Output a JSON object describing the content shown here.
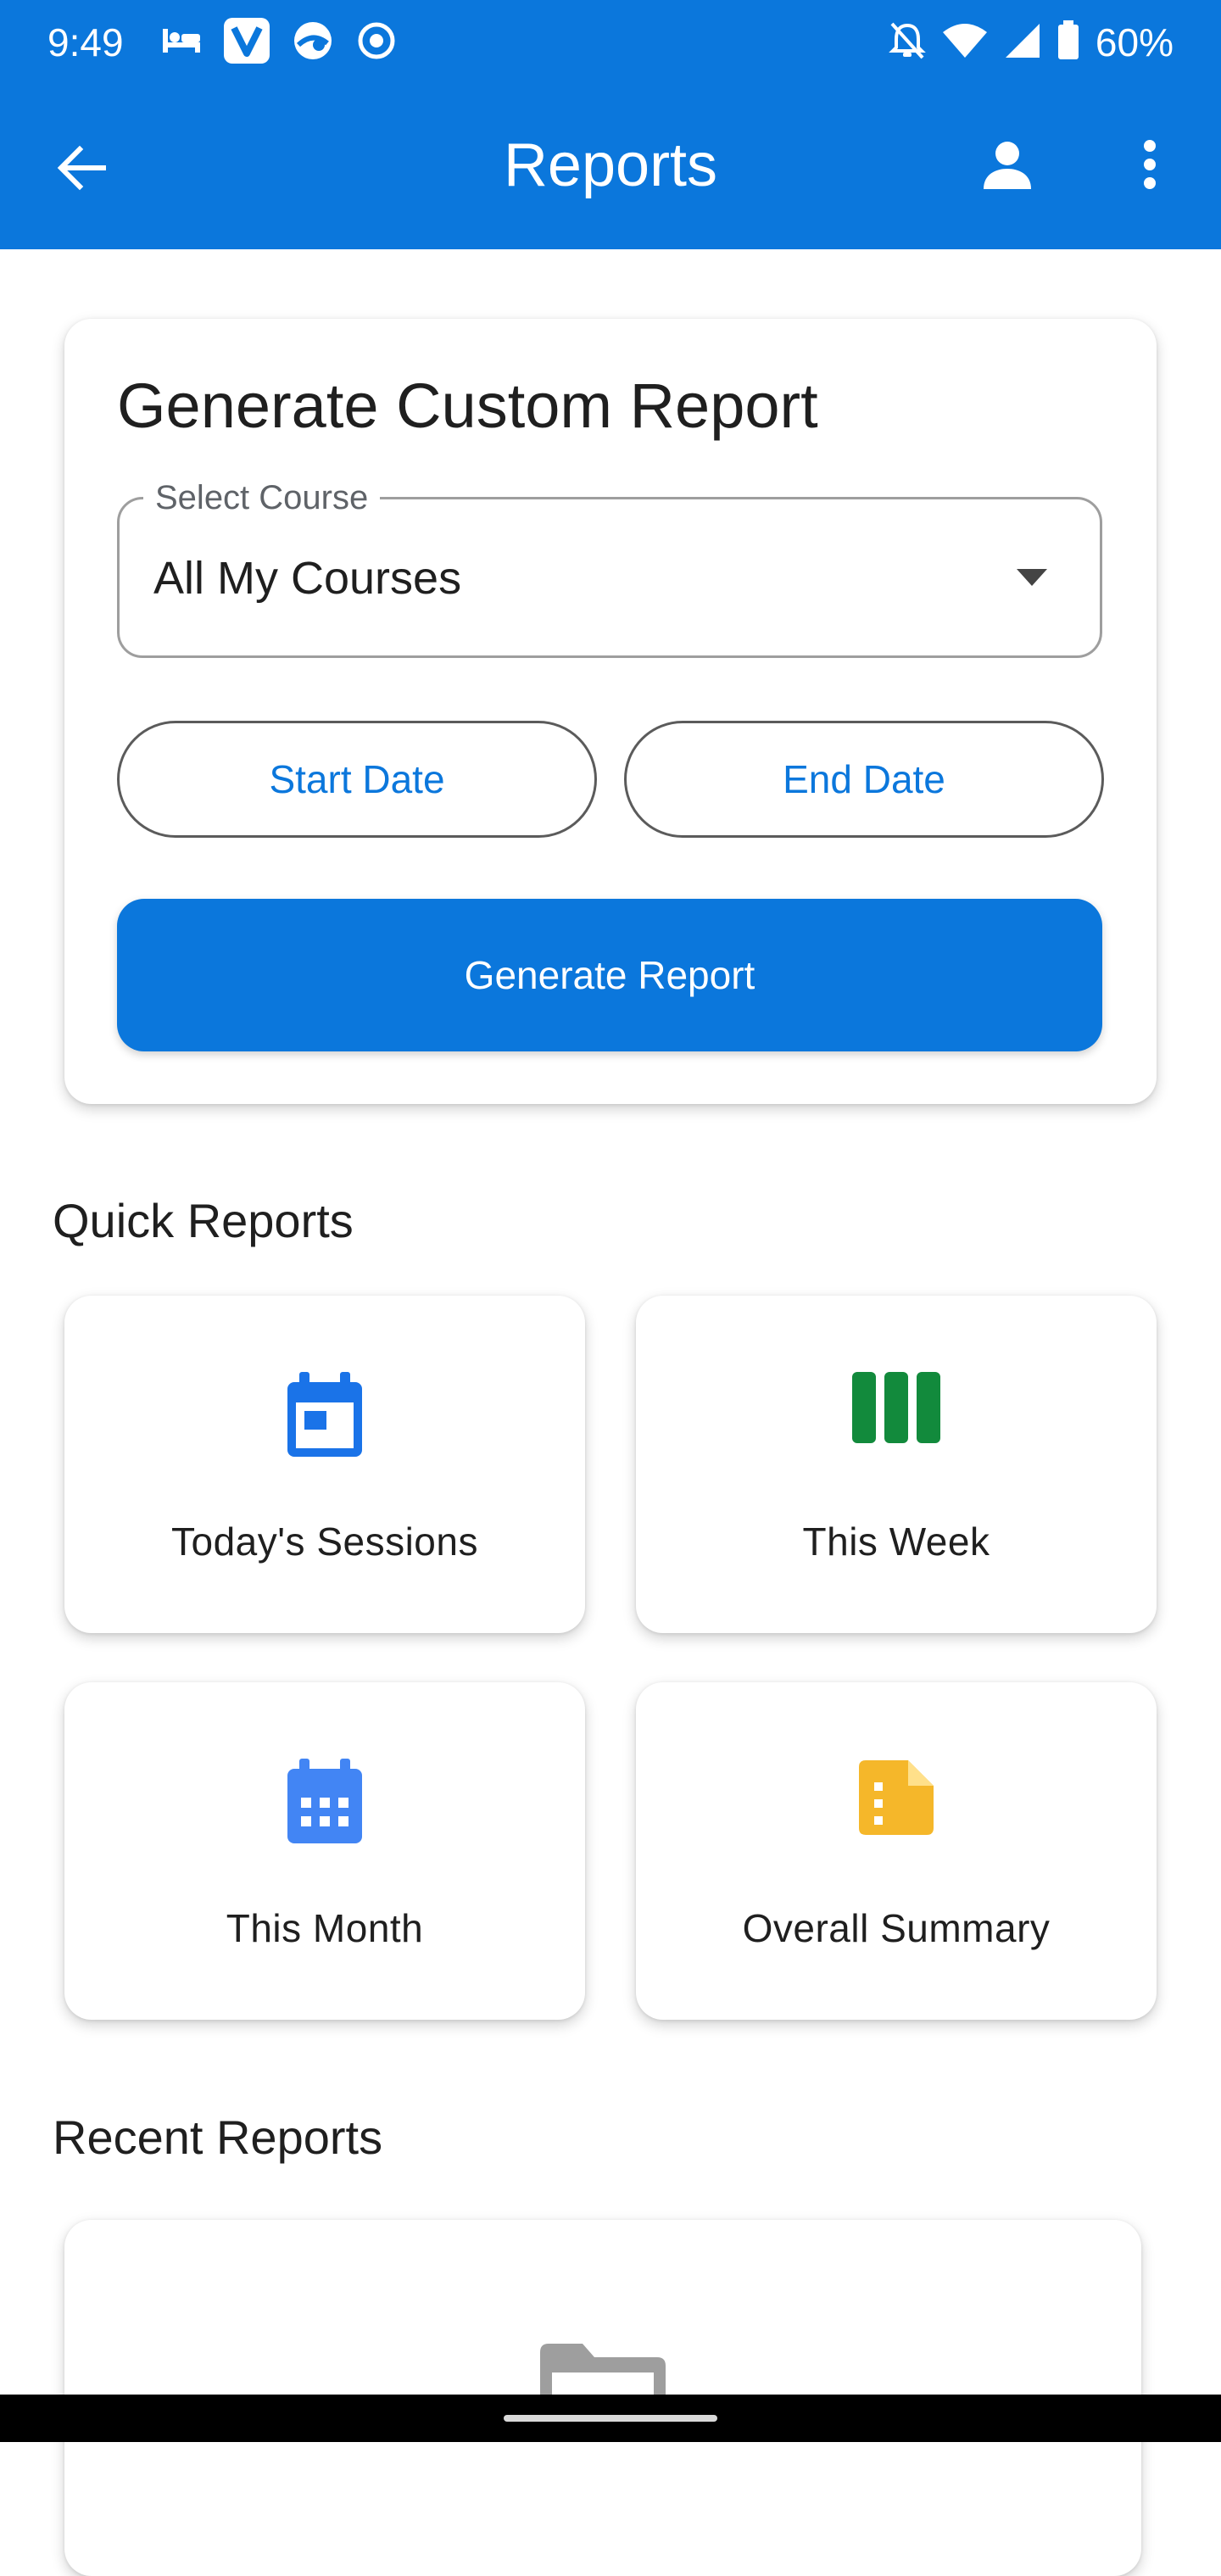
{
  "status_bar": {
    "time": "9:49",
    "left_icons": [
      "bed-icon",
      "v-app-icon",
      "browser-icon",
      "record-icon"
    ],
    "right_icons": [
      "bell-off-icon",
      "wifi-icon",
      "signal-icon",
      "battery-icon"
    ],
    "battery_text": "60%"
  },
  "toolbar": {
    "title": "Reports",
    "back_icon": "back-arrow-icon",
    "profile_icon": "person-icon",
    "more_icon": "more-vert-icon"
  },
  "custom_report": {
    "title": "Generate Custom Report",
    "select_label": "Select Course",
    "select_value": "All My Courses",
    "start_date": "Start Date",
    "end_date": "End Date",
    "generate_button": "Generate Report"
  },
  "quick_reports": {
    "title": "Quick Reports",
    "items": [
      {
        "label": "Today's Sessions",
        "icon": "calendar-today-icon",
        "color": "#1a73e8"
      },
      {
        "label": "This Week",
        "icon": "week-columns-icon",
        "color": "#128a3c"
      },
      {
        "label": "This Month",
        "icon": "calendar-month-icon",
        "color": "#4285f4"
      },
      {
        "label": "Overall Summary",
        "icon": "summary-document-icon",
        "color": "#f5b72a"
      }
    ]
  },
  "recent_reports": {
    "title": "Recent Reports",
    "empty_icon": "folder-icon"
  },
  "colors": {
    "primary": "#0b77dc",
    "background": "#ffffff"
  }
}
